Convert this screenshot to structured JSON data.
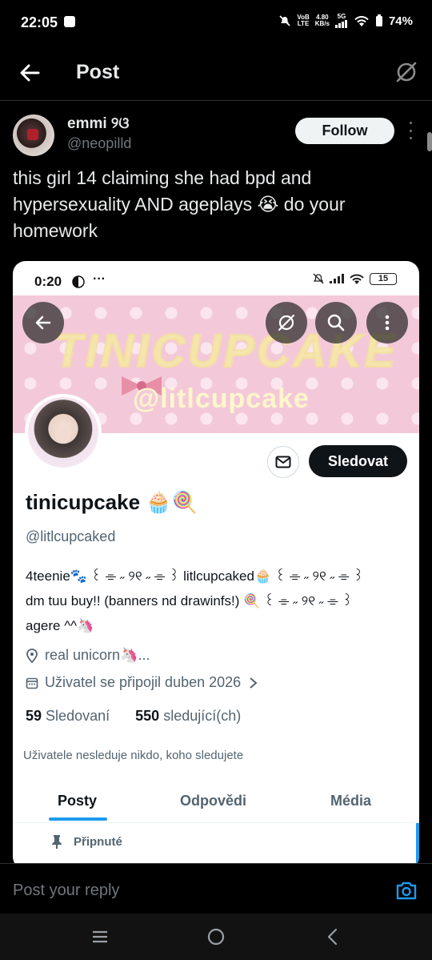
{
  "status_bar": {
    "time": "22:05",
    "net_top": "VoB",
    "net_bottom": "LTE",
    "speed_top": "4.80",
    "speed_bottom": "KB/s",
    "network": "5G",
    "battery": "74%"
  },
  "header": {
    "title": "Post"
  },
  "post": {
    "author_name": "emmi ୨ଓ",
    "author_handle": "@neopilld",
    "follow_label": "Follow",
    "text": "this girl 14 claiming she had bpd and hypersexuality AND ageplays 😭 do your homework"
  },
  "embedded_profile": {
    "status_time": "0:20",
    "status_dots": "···",
    "battery": "15",
    "banner_text": "TINICUPCAKE",
    "banner_subtext": "@litlcupcake",
    "follow_label": "Sledovat",
    "display_name": "tinicupcake 🧁🍭",
    "handle": "@litlcupcaked",
    "bio_line1": "4teenie🐾 ꒰ ⌯ ˶ ୨୧ ˶ ⌯ ꒱ litlcupcaked🧁 ꒰ ⌯ ˶ ୨୧ ˶ ⌯ ꒱",
    "bio_line2": "dm tuu buy!! (banners nd drawinfs!) 🍭 ꒰ ⌯ ˶ ୨୧ ˶ ⌯ ꒱",
    "bio_line3": "agere ^^🦄",
    "location": "real unicorn🦄...",
    "joined": "Uživatel se připojil duben 2026",
    "following_count": "59",
    "following_label": "Sledovaní",
    "followers_count": "550",
    "followers_label": "sledující(ch)",
    "note": "Uživatele nesleduje nikdo, koho sledujete",
    "tabs": [
      "Posty",
      "Odpovědi",
      "Média"
    ],
    "pinned_label": "Připnuté"
  },
  "reply": {
    "placeholder": "Post your reply"
  },
  "colors": {
    "background": "#000000",
    "accent": "#1d9bf0",
    "banner_pink": "#f3c9d9"
  }
}
